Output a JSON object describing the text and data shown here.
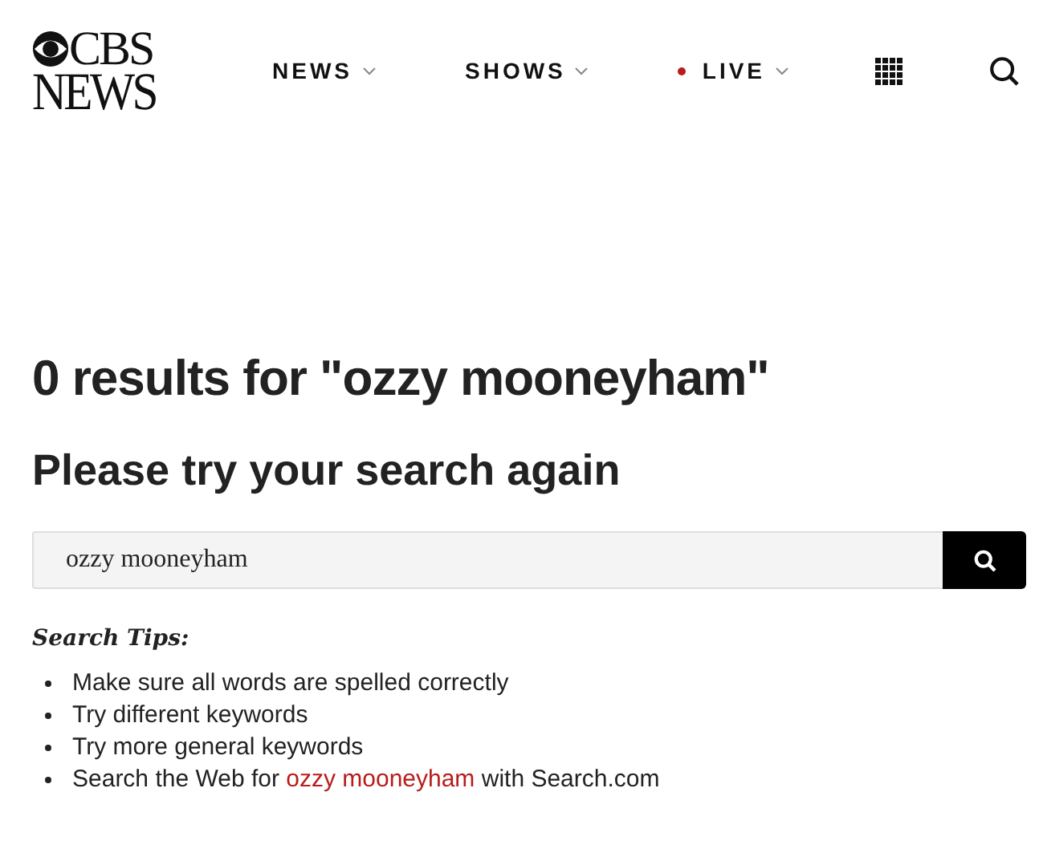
{
  "logo": {
    "line_1": "CBS",
    "line_2": "NEWS"
  },
  "nav": [
    {
      "label": "NEWS",
      "live": false
    },
    {
      "label": "SHOWS",
      "live": false
    },
    {
      "label": "LIVE",
      "live": true
    }
  ],
  "heading": "0 results for \"ozzy mooneyham\"",
  "subheading": "Please try your search again",
  "search": {
    "value": "ozzy mooneyham"
  },
  "tips_title": "Search Tips:",
  "tips": [
    {
      "kind": "text",
      "text": "Make sure all words are spelled correctly"
    },
    {
      "kind": "text",
      "text": "Try different keywords"
    },
    {
      "kind": "text",
      "text": "Try more general keywords"
    },
    {
      "kind": "link",
      "before": "Search the Web for",
      "link": "ozzy mooneyham",
      "after": "with Search.com"
    }
  ]
}
